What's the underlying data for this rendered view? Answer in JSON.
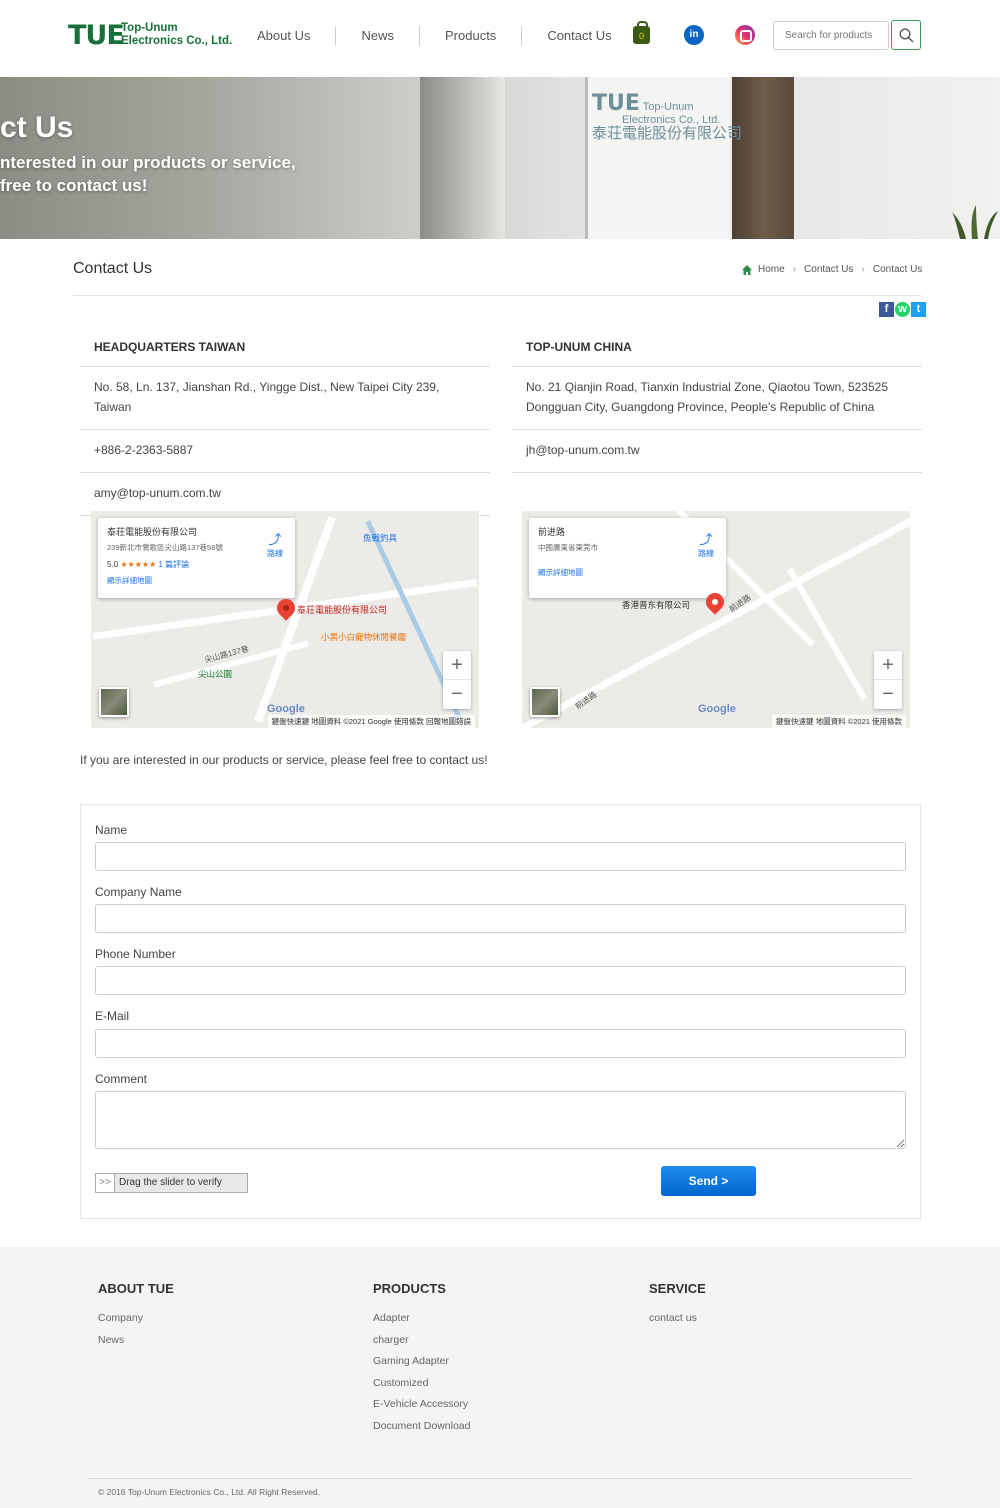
{
  "header": {
    "logo_mark": "TUE",
    "logo_line1": "Top-Unum",
    "logo_line2": "Electronics Co., Ltd.",
    "nav": [
      "About Us",
      "News",
      "Products",
      "Contact Us"
    ],
    "cart_count": "0",
    "linkedin_glyph": "in",
    "search_placeholder": "Search for products"
  },
  "banner": {
    "title": "ct Us",
    "subtitle_line1": "nterested in our products or service,",
    "subtitle_line2": "free to contact us!",
    "sign_mark": "TUE",
    "sign_line1": "Top-Unum",
    "sign_line2": "Electronics Co., Ltd.",
    "sign_cn": "泰荘電能股份有限公司"
  },
  "page": {
    "title": "Contact Us",
    "breadcrumb": [
      "Home",
      "Contact Us",
      "Contact Us"
    ]
  },
  "social": {
    "facebook": "f",
    "whatsapp": "w",
    "twitter": "t"
  },
  "contacts": {
    "left": {
      "title": "HEADQUARTERS TAIWAN",
      "address": "No. 58, Ln. 137, Jianshan Rd., Yingge Dist., New Taipei City 239, Taiwan",
      "phone": "+886-2-2363-5887",
      "email": "amy@top-unum.com.tw"
    },
    "right": {
      "title": "TOP-UNUM CHINA",
      "address_line1": "No. 21 Qianjin Road, Tianxin Industrial Zone, Qiaotou Town, 523525",
      "address_line2": "Dongguan City, Guangdong Province, People's Republic of China",
      "email": "jh@top-unum.com.tw"
    }
  },
  "maps": {
    "left": {
      "place": "泰荘電能股份有限公司",
      "address": "239新北市鶯歌區尖山路137巷58號",
      "rating": "5.0",
      "stars": "★★★★★",
      "reviews": "1 篇評論",
      "larger_map": "顯示詳細地圖",
      "directions": "路線",
      "pin_label": "泰荘電能股份有限公司",
      "poi1": "魚戰釣具",
      "poi2": "小黑小白寵物休閒餐廳",
      "poi3": "尖山公園",
      "street": "尖山路137巷",
      "google": "Google",
      "footer": "鍵盤快速鍵   地圖資料 ©2021 Google   使用條款   回報地圖錯誤",
      "zoom_in": "+",
      "zoom_out": "−"
    },
    "right": {
      "place": "前进路",
      "address": "中國廣東省東莞市",
      "larger_map": "顯示詳細地圖",
      "directions": "路線",
      "pin_label": "香港晋东有限公司",
      "street1": "前进路",
      "street2": "前进路",
      "google": "Google",
      "footer": "鍵盤快速鍵   地圖資料 ©2021   使用條款",
      "zoom_in": "+",
      "zoom_out": "−"
    }
  },
  "intro": "If you are interested in our products or service, please feel free to contact us!",
  "form": {
    "name_label": "Name",
    "company_label": "Company Name",
    "phone_label": "Phone Number",
    "email_label": "E-Mail",
    "comment_label": "Comment",
    "slider_handle": ">>",
    "slider_text": "Drag the slider to verify",
    "send_label": "Send >"
  },
  "footer": {
    "about": {
      "title": "ABOUT TUE",
      "items": [
        "Company",
        "News"
      ]
    },
    "products": {
      "title": "PRODUCTS",
      "items": [
        "Adapter",
        "charger",
        "Gaming Adapter",
        "Customized",
        "E-Vehicle Accessory",
        "Document Download"
      ]
    },
    "service": {
      "title": "SERVICE",
      "items": [
        "contact us"
      ]
    },
    "copyright": "© 2016 Top-Unum Electronics Co., Ltd. All Right Reserved."
  },
  "colors": {
    "brand_green": "#17703a",
    "send_blue": "#0a75e0",
    "footer_bg": "#f4f4f4"
  }
}
